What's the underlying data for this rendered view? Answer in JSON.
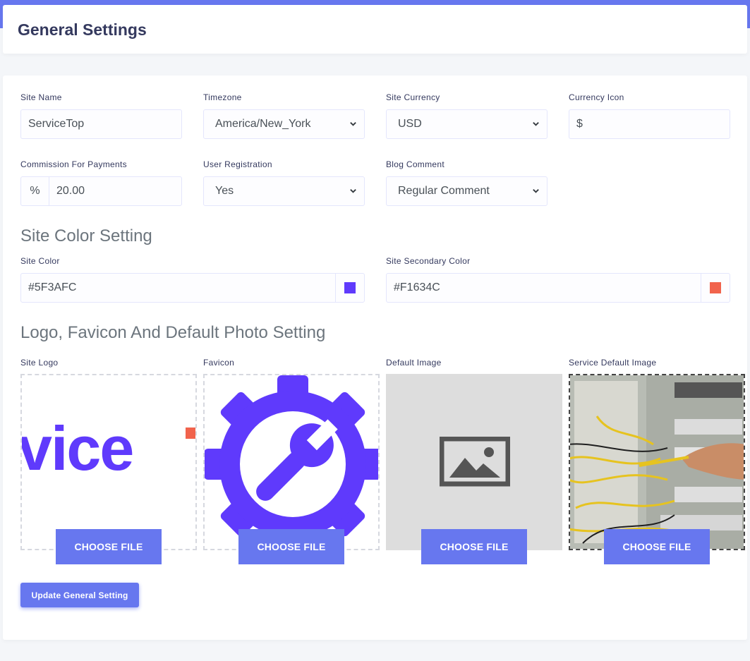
{
  "page": {
    "title": "General Settings"
  },
  "colors": {
    "accent": "#6777ef",
    "site_color": "#5F3AFC",
    "secondary_color": "#F1634C",
    "placeholder_bg": "#dddddd"
  },
  "fields": {
    "site_name": {
      "label": "Site Name",
      "value": "ServiceTop"
    },
    "timezone": {
      "label": "Timezone",
      "value": "America/New_York"
    },
    "site_currency": {
      "label": "Site Currency",
      "value": "USD"
    },
    "currency_icon": {
      "label": "Currency Icon",
      "value": "$"
    },
    "commission": {
      "label": "Commission For Payments",
      "prefix": "%",
      "value": "20.00"
    },
    "user_registration": {
      "label": "User Registration",
      "value": "Yes"
    },
    "blog_comment": {
      "label": "Blog Comment",
      "value": "Regular Comment"
    }
  },
  "color_section": {
    "title": "Site Color Setting",
    "site_color": {
      "label": "Site Color",
      "value": "#5F3AFC"
    },
    "secondary_color": {
      "label": "Site Secondary Color",
      "value": "#F1634C"
    }
  },
  "media_section": {
    "title": "Logo, Favicon And Default Photo Setting",
    "site_logo": {
      "label": "Site Logo",
      "logo_text": "vice",
      "button": "CHOOSE FILE"
    },
    "favicon": {
      "label": "Favicon",
      "icon": "gear-wrench-icon",
      "button": "CHOOSE FILE"
    },
    "default_image": {
      "label": "Default Image",
      "icon": "image-placeholder-icon",
      "button": "CHOOSE FILE"
    },
    "service_default_image": {
      "label": "Service Default Image",
      "icon": "electrical-panel-photo",
      "button": "CHOOSE FILE"
    }
  },
  "actions": {
    "update": "Update General Setting"
  }
}
